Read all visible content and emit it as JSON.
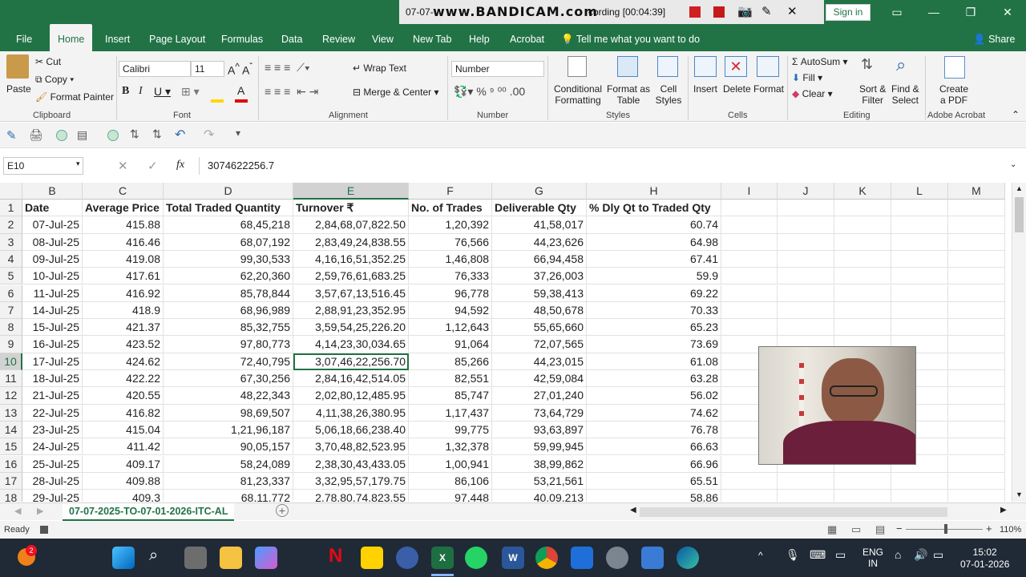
{
  "titlebar": {
    "recorder_text": "07-07-",
    "recorder_brand": "www.BANDICAM.com",
    "recorder_status": "cording [00:04:39]",
    "signin": "Sign in"
  },
  "tabs": [
    "File",
    "Home",
    "Insert",
    "Page Layout",
    "Formulas",
    "Data",
    "Review",
    "View",
    "New Tab",
    "Help",
    "Acrobat"
  ],
  "tell_me": "Tell me what you want to do",
  "share": "Share",
  "ribbon": {
    "paste": "Paste",
    "cut": "Cut",
    "copy": "Copy",
    "format_painter": "Format Painter",
    "clipboard": "Clipboard",
    "font_name": "Calibri",
    "font_size": "11",
    "font": "Font",
    "wrap_text": "Wrap Text",
    "merge_center": "Merge & Center",
    "alignment": "Alignment",
    "number_format": "Number",
    "number": "Number",
    "conditional": "Conditional",
    "formatting": "Formatting",
    "format_as": "Format as",
    "table": "Table",
    "cell": "Cell",
    "styles_btn": "Styles",
    "styles": "Styles",
    "insert": "Insert",
    "delete": "Delete",
    "format": "Format",
    "cells": "Cells",
    "autosum": "AutoSum",
    "fill": "Fill",
    "clear": "Clear",
    "sort_filter_1": "Sort &",
    "sort_filter_2": "Filter",
    "find_select_1": "Find &",
    "find_select_2": "Select",
    "editing": "Editing",
    "create": "Create",
    "a_pdf": "a PDF",
    "adobe_acrobat": "Adobe Acrobat"
  },
  "formula_bar": {
    "name_box": "E10",
    "fx": "fx",
    "value": "3074622256.7"
  },
  "columns": [
    {
      "letter": "B",
      "w": 75
    },
    {
      "letter": "C",
      "w": 101
    },
    {
      "letter": "D",
      "w": 162
    },
    {
      "letter": "E",
      "w": 144
    },
    {
      "letter": "F",
      "w": 104
    },
    {
      "letter": "G",
      "w": 118
    },
    {
      "letter": "H",
      "w": 168
    },
    {
      "letter": "I",
      "w": 70
    },
    {
      "letter": "J",
      "w": 71
    },
    {
      "letter": "K",
      "w": 71
    },
    {
      "letter": "L",
      "w": 71
    },
    {
      "letter": "M",
      "w": 71
    }
  ],
  "header_row": [
    "Date",
    "Average Price",
    "Total Traded Quantity",
    "Turnover ₹",
    "No. of Trades",
    "Deliverable Qty",
    "% Dly Qt to Traded Qty"
  ],
  "rows": [
    [
      "07-Jul-25",
      "415.88",
      "68,45,218",
      "2,84,68,07,822.50",
      "1,20,392",
      "41,58,017",
      "60.74"
    ],
    [
      "08-Jul-25",
      "416.46",
      "68,07,192",
      "2,83,49,24,838.55",
      "76,566",
      "44,23,626",
      "64.98"
    ],
    [
      "09-Jul-25",
      "419.08",
      "99,30,533",
      "4,16,16,51,352.25",
      "1,46,808",
      "66,94,458",
      "67.41"
    ],
    [
      "10-Jul-25",
      "417.61",
      "62,20,360",
      "2,59,76,61,683.25",
      "76,333",
      "37,26,003",
      "59.9"
    ],
    [
      "11-Jul-25",
      "416.92",
      "85,78,844",
      "3,57,67,13,516.45",
      "96,778",
      "59,38,413",
      "69.22"
    ],
    [
      "14-Jul-25",
      "418.9",
      "68,96,989",
      "2,88,91,23,352.95",
      "94,592",
      "48,50,678",
      "70.33"
    ],
    [
      "15-Jul-25",
      "421.37",
      "85,32,755",
      "3,59,54,25,226.20",
      "1,12,643",
      "55,65,660",
      "65.23"
    ],
    [
      "16-Jul-25",
      "423.52",
      "97,80,773",
      "4,14,23,30,034.65",
      "91,064",
      "72,07,565",
      "73.69"
    ],
    [
      "17-Jul-25",
      "424.62",
      "72,40,795",
      "3,07,46,22,256.70",
      "85,266",
      "44,23,015",
      "61.08"
    ],
    [
      "18-Jul-25",
      "422.22",
      "67,30,256",
      "2,84,16,42,514.05",
      "82,551",
      "42,59,084",
      "63.28"
    ],
    [
      "21-Jul-25",
      "420.55",
      "48,22,343",
      "2,02,80,12,485.95",
      "85,747",
      "27,01,240",
      "56.02"
    ],
    [
      "22-Jul-25",
      "416.82",
      "98,69,507",
      "4,11,38,26,380.95",
      "1,17,437",
      "73,64,729",
      "74.62"
    ],
    [
      "23-Jul-25",
      "415.04",
      "1,21,96,187",
      "5,06,18,66,238.40",
      "99,775",
      "93,63,897",
      "76.78"
    ],
    [
      "24-Jul-25",
      "411.42",
      "90,05,157",
      "3,70,48,82,523.95",
      "1,32,378",
      "59,99,945",
      "66.63"
    ],
    [
      "25-Jul-25",
      "409.17",
      "58,24,089",
      "2,38,30,43,433.05",
      "1,00,941",
      "38,99,862",
      "66.96"
    ],
    [
      "28-Jul-25",
      "409.88",
      "81,23,337",
      "3,32,95,57,179.75",
      "86,106",
      "53,21,561",
      "65.51"
    ],
    [
      "29-Jul-25",
      "409.3",
      "68,11,772",
      "2,78,80,74,823.55",
      "97,448",
      "40,09,213",
      "58.86"
    ]
  ],
  "selected_cell": {
    "row": 10,
    "col": "E"
  },
  "sheet_tab": "07-07-2025-TO-07-01-2026-ITC-AL",
  "status": {
    "ready": "Ready",
    "zoom": "110%"
  },
  "taskbar": {
    "lang1": "ENG",
    "lang2": "IN",
    "time": "15:02",
    "date": "07-01-2026",
    "badge": "2"
  }
}
